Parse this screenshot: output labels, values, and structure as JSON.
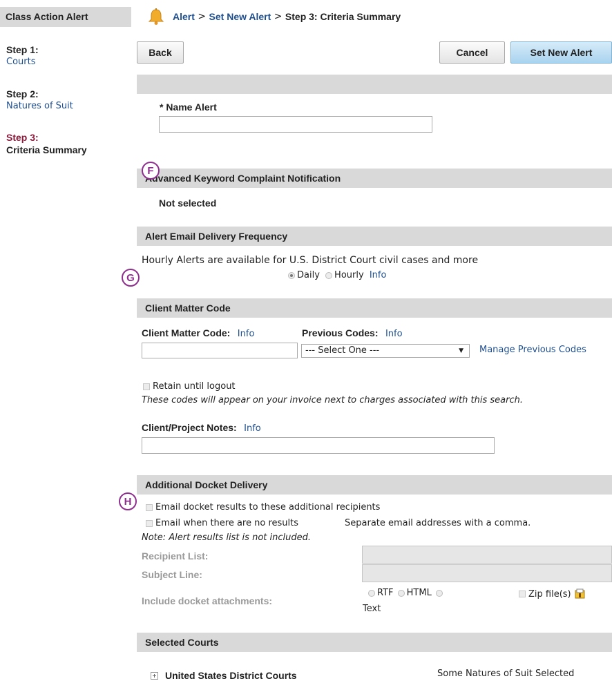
{
  "sidebar": {
    "title": "Class Action Alert",
    "steps": [
      {
        "label": "Step 1:",
        "name": "Courts"
      },
      {
        "label": "Step 2:",
        "name": "Natures of Suit"
      },
      {
        "label": "Step 3:",
        "name": "Criteria Summary"
      }
    ]
  },
  "breadcrumb": {
    "alert": "Alert",
    "sep1": " > ",
    "set_new_alert": "Set New Alert",
    "sep2": " > ",
    "current": "Step 3: Criteria Summary"
  },
  "toolbar": {
    "back": "Back",
    "cancel": "Cancel",
    "set_new_alert": "Set New Alert"
  },
  "name_alert": {
    "label": "* Name Alert",
    "value": ""
  },
  "markers": {
    "f": "F",
    "g": "G",
    "h": "H"
  },
  "keyword_section": {
    "title": "Advanced Keyword Complaint Notification",
    "value": "Not selected"
  },
  "frequency_section": {
    "title": "Alert Email Delivery Frequency",
    "note": "Hourly Alerts are available for U.S. District Court civil cases and more",
    "daily": "Daily",
    "hourly": "Hourly",
    "info": "Info",
    "selected": "Daily"
  },
  "client_matter": {
    "title": "Client Matter Code",
    "code_label": "Client Matter Code:",
    "code_info": "Info",
    "prev_label": "Previous Codes:",
    "prev_info": "Info",
    "select_value": "--- Select One ---",
    "manage_link": "Manage Previous Codes",
    "retain": "Retain until logout",
    "invoice_note": "These codes will appear on your invoice next to charges associated with this search.",
    "notes_label": "Client/Project Notes:",
    "notes_info": "Info"
  },
  "docket": {
    "title": "Additional Docket Delivery",
    "email_recipients": "Email docket results to these additional recipients",
    "email_no_results": "Email when there are no results",
    "separate_note": "Separate email addresses with a comma.",
    "note": "Note: Alert results list is not included.",
    "recipient_label": "Recipient List:",
    "subject_label": "Subject Line:",
    "attachments_label": "Include docket attachments:",
    "rtf": "RTF",
    "html": "HTML",
    "text": "Text",
    "zip": "Zip file(s)"
  },
  "courts": {
    "title": "Selected Courts",
    "item": "United States District Courts",
    "status": "Some Natures of Suit Selected"
  },
  "colors": {
    "link": "#1f4f8f",
    "step_active": "#8b1a3a",
    "marker": "#8e2f8e",
    "primary_button": "#a9d3ef"
  }
}
